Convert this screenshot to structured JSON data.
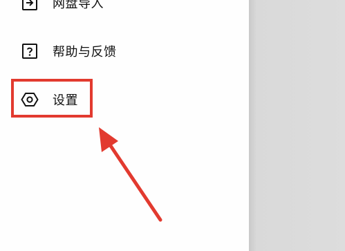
{
  "menu": {
    "items": [
      {
        "label": "网盘导入",
        "icon": "import-icon"
      },
      {
        "label": "帮助与反馈",
        "icon": "help-icon"
      },
      {
        "label": "设置",
        "icon": "settings-hex-icon"
      }
    ]
  },
  "annotation": {
    "box_color": "#e23a2f",
    "arrow_color": "#e23a2f"
  }
}
